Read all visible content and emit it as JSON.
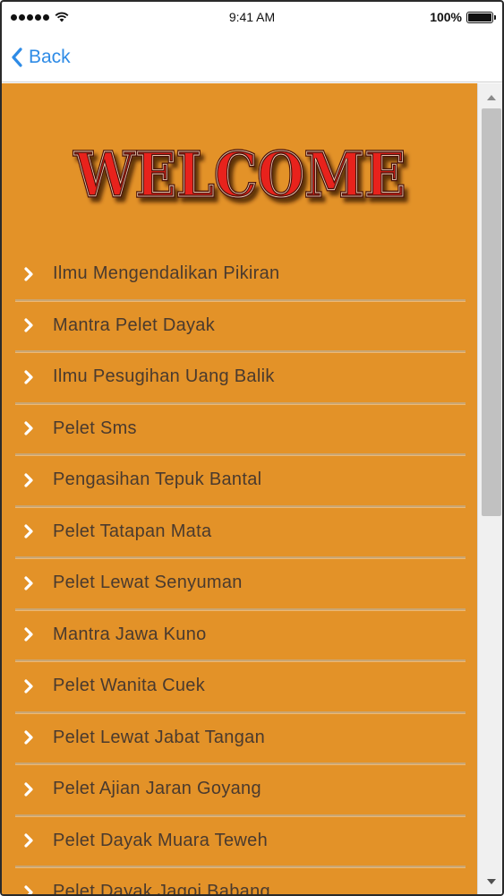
{
  "status_bar": {
    "time": "9:41 AM",
    "battery": "100%",
    "battery_level": 1.0,
    "icons": [
      "signal-icon",
      "wifi-icon",
      "battery-icon"
    ]
  },
  "nav": {
    "back_label": "Back",
    "back_icon": "chevron-left-icon"
  },
  "header": {
    "welcome_text": "WELCOME"
  },
  "menu": {
    "items": [
      {
        "label": "Ilmu Mengendalikan Pikiran"
      },
      {
        "label": "Mantra Pelet Dayak"
      },
      {
        "label": "Ilmu Pesugihan Uang Balik"
      },
      {
        "label": "Pelet Sms"
      },
      {
        "label": "Pengasihan Tepuk Bantal"
      },
      {
        "label": "Pelet Tatapan Mata"
      },
      {
        "label": "Pelet Lewat Senyuman"
      },
      {
        "label": "Mantra Jawa Kuno"
      },
      {
        "label": "Pelet Wanita Cuek"
      },
      {
        "label": "Pelet Lewat Jabat Tangan"
      },
      {
        "label": "Pelet Ajian Jaran Goyang"
      },
      {
        "label": "Pelet Dayak Muara Teweh"
      },
      {
        "label": "Pelet Dayak Jagoi Babang"
      }
    ]
  },
  "colors": {
    "background": "#e39228",
    "link": "#2e8be6",
    "item_text": "#4a3a2e",
    "welcome_fill": "#e8231a",
    "welcome_outline": "#4a1208"
  }
}
